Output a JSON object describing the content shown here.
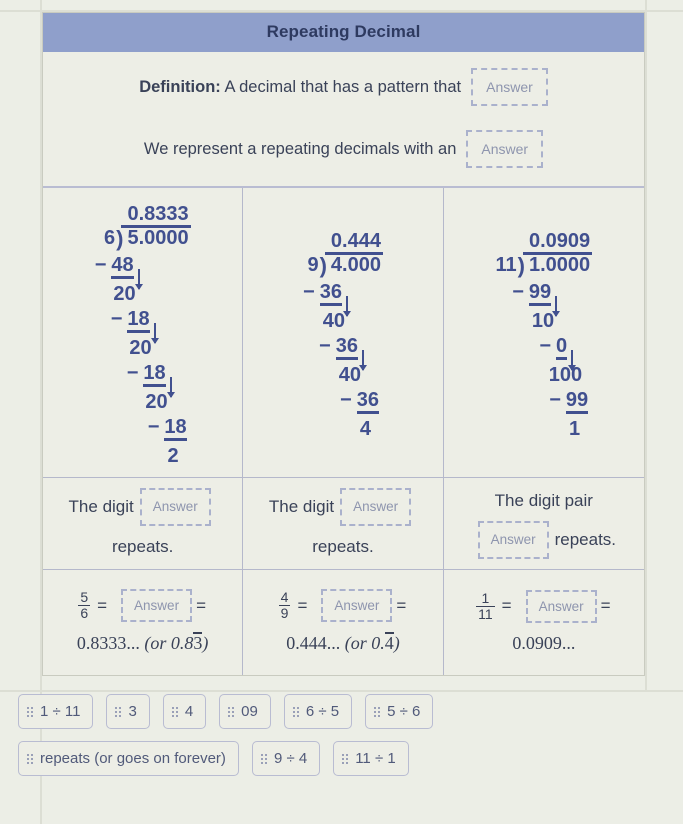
{
  "header": {
    "title": "Repeating Decimal"
  },
  "definition": {
    "line1_text": "Definition:",
    "line1_rest": " A decimal that has a pattern that",
    "line1_answer": "Answer",
    "line2_text": "We represent a repeating decimals with an",
    "line2_answer": "Answer"
  },
  "columns": [
    {
      "division": {
        "quotient": "0.8333",
        "divisor": "6",
        "dividend": "5.0000",
        "steps": [
          {
            "minus": "−",
            "value": "48",
            "arrow": true,
            "bring_down": "20"
          },
          {
            "minus": "−",
            "value": "18",
            "arrow": true,
            "bring_down": "20"
          },
          {
            "minus": "−",
            "value": "18",
            "arrow": true,
            "bring_down": "20"
          },
          {
            "minus": "−",
            "value": "18",
            "arrow": false,
            "bring_down": "2"
          }
        ]
      },
      "repeat_prefix": "The digit",
      "repeat_answer": "Answer",
      "repeat_suffix": "repeats.",
      "fraction_num": "5",
      "fraction_den": "6",
      "eq1": "=",
      "frac_answer": "Answer",
      "eq2": "=",
      "decimal_plain": "0.8333...",
      "decimal_or_open": "(or 0.8",
      "decimal_overline": "3",
      "decimal_or_close": ")"
    },
    {
      "division": {
        "quotient": "0.444",
        "divisor": "9",
        "dividend": "4.000",
        "steps": [
          {
            "minus": "−",
            "value": "36",
            "arrow": true,
            "bring_down": "40"
          },
          {
            "minus": "−",
            "value": "36",
            "arrow": true,
            "bring_down": "40"
          },
          {
            "minus": "−",
            "value": "36",
            "arrow": false,
            "bring_down": "4"
          }
        ]
      },
      "repeat_prefix": "The digit",
      "repeat_answer": "Answer",
      "repeat_suffix": "repeats.",
      "fraction_num": "4",
      "fraction_den": "9",
      "eq1": "=",
      "frac_answer": "Answer",
      "eq2": "=",
      "decimal_plain": "0.444...",
      "decimal_or_open": "(or 0.",
      "decimal_overline": "4",
      "decimal_or_close": ")"
    },
    {
      "division": {
        "quotient": "0.0909",
        "divisor": "11",
        "dividend": "1.0000",
        "steps": [
          {
            "minus": "−",
            "value": "99",
            "arrow": true,
            "bring_down": "10"
          },
          {
            "minus": "−",
            "value": "0",
            "arrow": true,
            "bring_down": "100"
          },
          {
            "minus": "−",
            "value": "99",
            "arrow": false,
            "bring_down": "1"
          }
        ]
      },
      "repeat_prefix": "The digit pair",
      "repeat_answer": "Answer",
      "repeat_suffix": "repeats.",
      "fraction_num": "1",
      "fraction_den": "11",
      "eq1": "=",
      "frac_answer": "Answer",
      "eq2": "=",
      "decimal_plain": "0.0909...",
      "decimal_or_open": "",
      "decimal_overline": "",
      "decimal_or_close": ""
    }
  ],
  "answer_bank": {
    "rows": [
      [
        "1 ÷ 11",
        "3",
        "4",
        "09",
        "6 ÷ 5",
        "5 ÷ 6"
      ],
      [
        "repeats (or goes on forever)",
        "9 ÷ 4",
        "11 ÷ 1"
      ]
    ]
  },
  "colors": {
    "header_band": "#8f9fcb",
    "ink_blue": "#41508f",
    "text": "#3a4258",
    "answer_placeholder": "#8e95ae",
    "page_bg": "#eceee6"
  }
}
